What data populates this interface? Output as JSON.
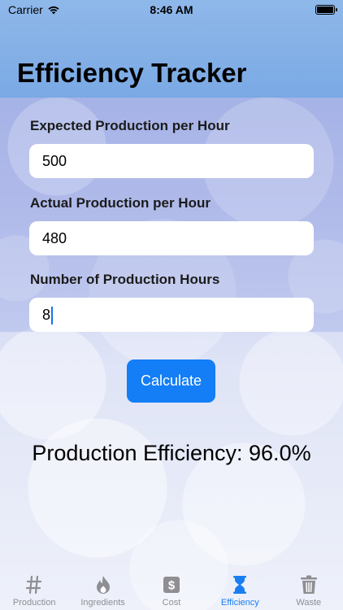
{
  "status_bar": {
    "carrier": "Carrier",
    "time": "8:46 AM"
  },
  "title": "Efficiency Tracker",
  "fields": [
    {
      "label": "Expected Production per Hour",
      "value": "500"
    },
    {
      "label": "Actual Production per Hour",
      "value": "480"
    },
    {
      "label": "Number of Production Hours",
      "value": "8"
    }
  ],
  "calculate_label": "Calculate",
  "result": "Production Efficiency: 96.0%",
  "tabs": [
    {
      "label": "Production",
      "icon": "hash-icon"
    },
    {
      "label": "Ingredients",
      "icon": "flame-icon"
    },
    {
      "label": "Cost",
      "icon": "dollar-icon"
    },
    {
      "label": "Efficiency",
      "icon": "hourglass-icon",
      "active": true
    },
    {
      "label": "Waste",
      "icon": "trash-icon"
    }
  ],
  "colors": {
    "accent": "#137ef5",
    "tab_active": "#1a7ef2",
    "tab_inactive": "#8e8e93",
    "header": "#7aa9e4"
  }
}
